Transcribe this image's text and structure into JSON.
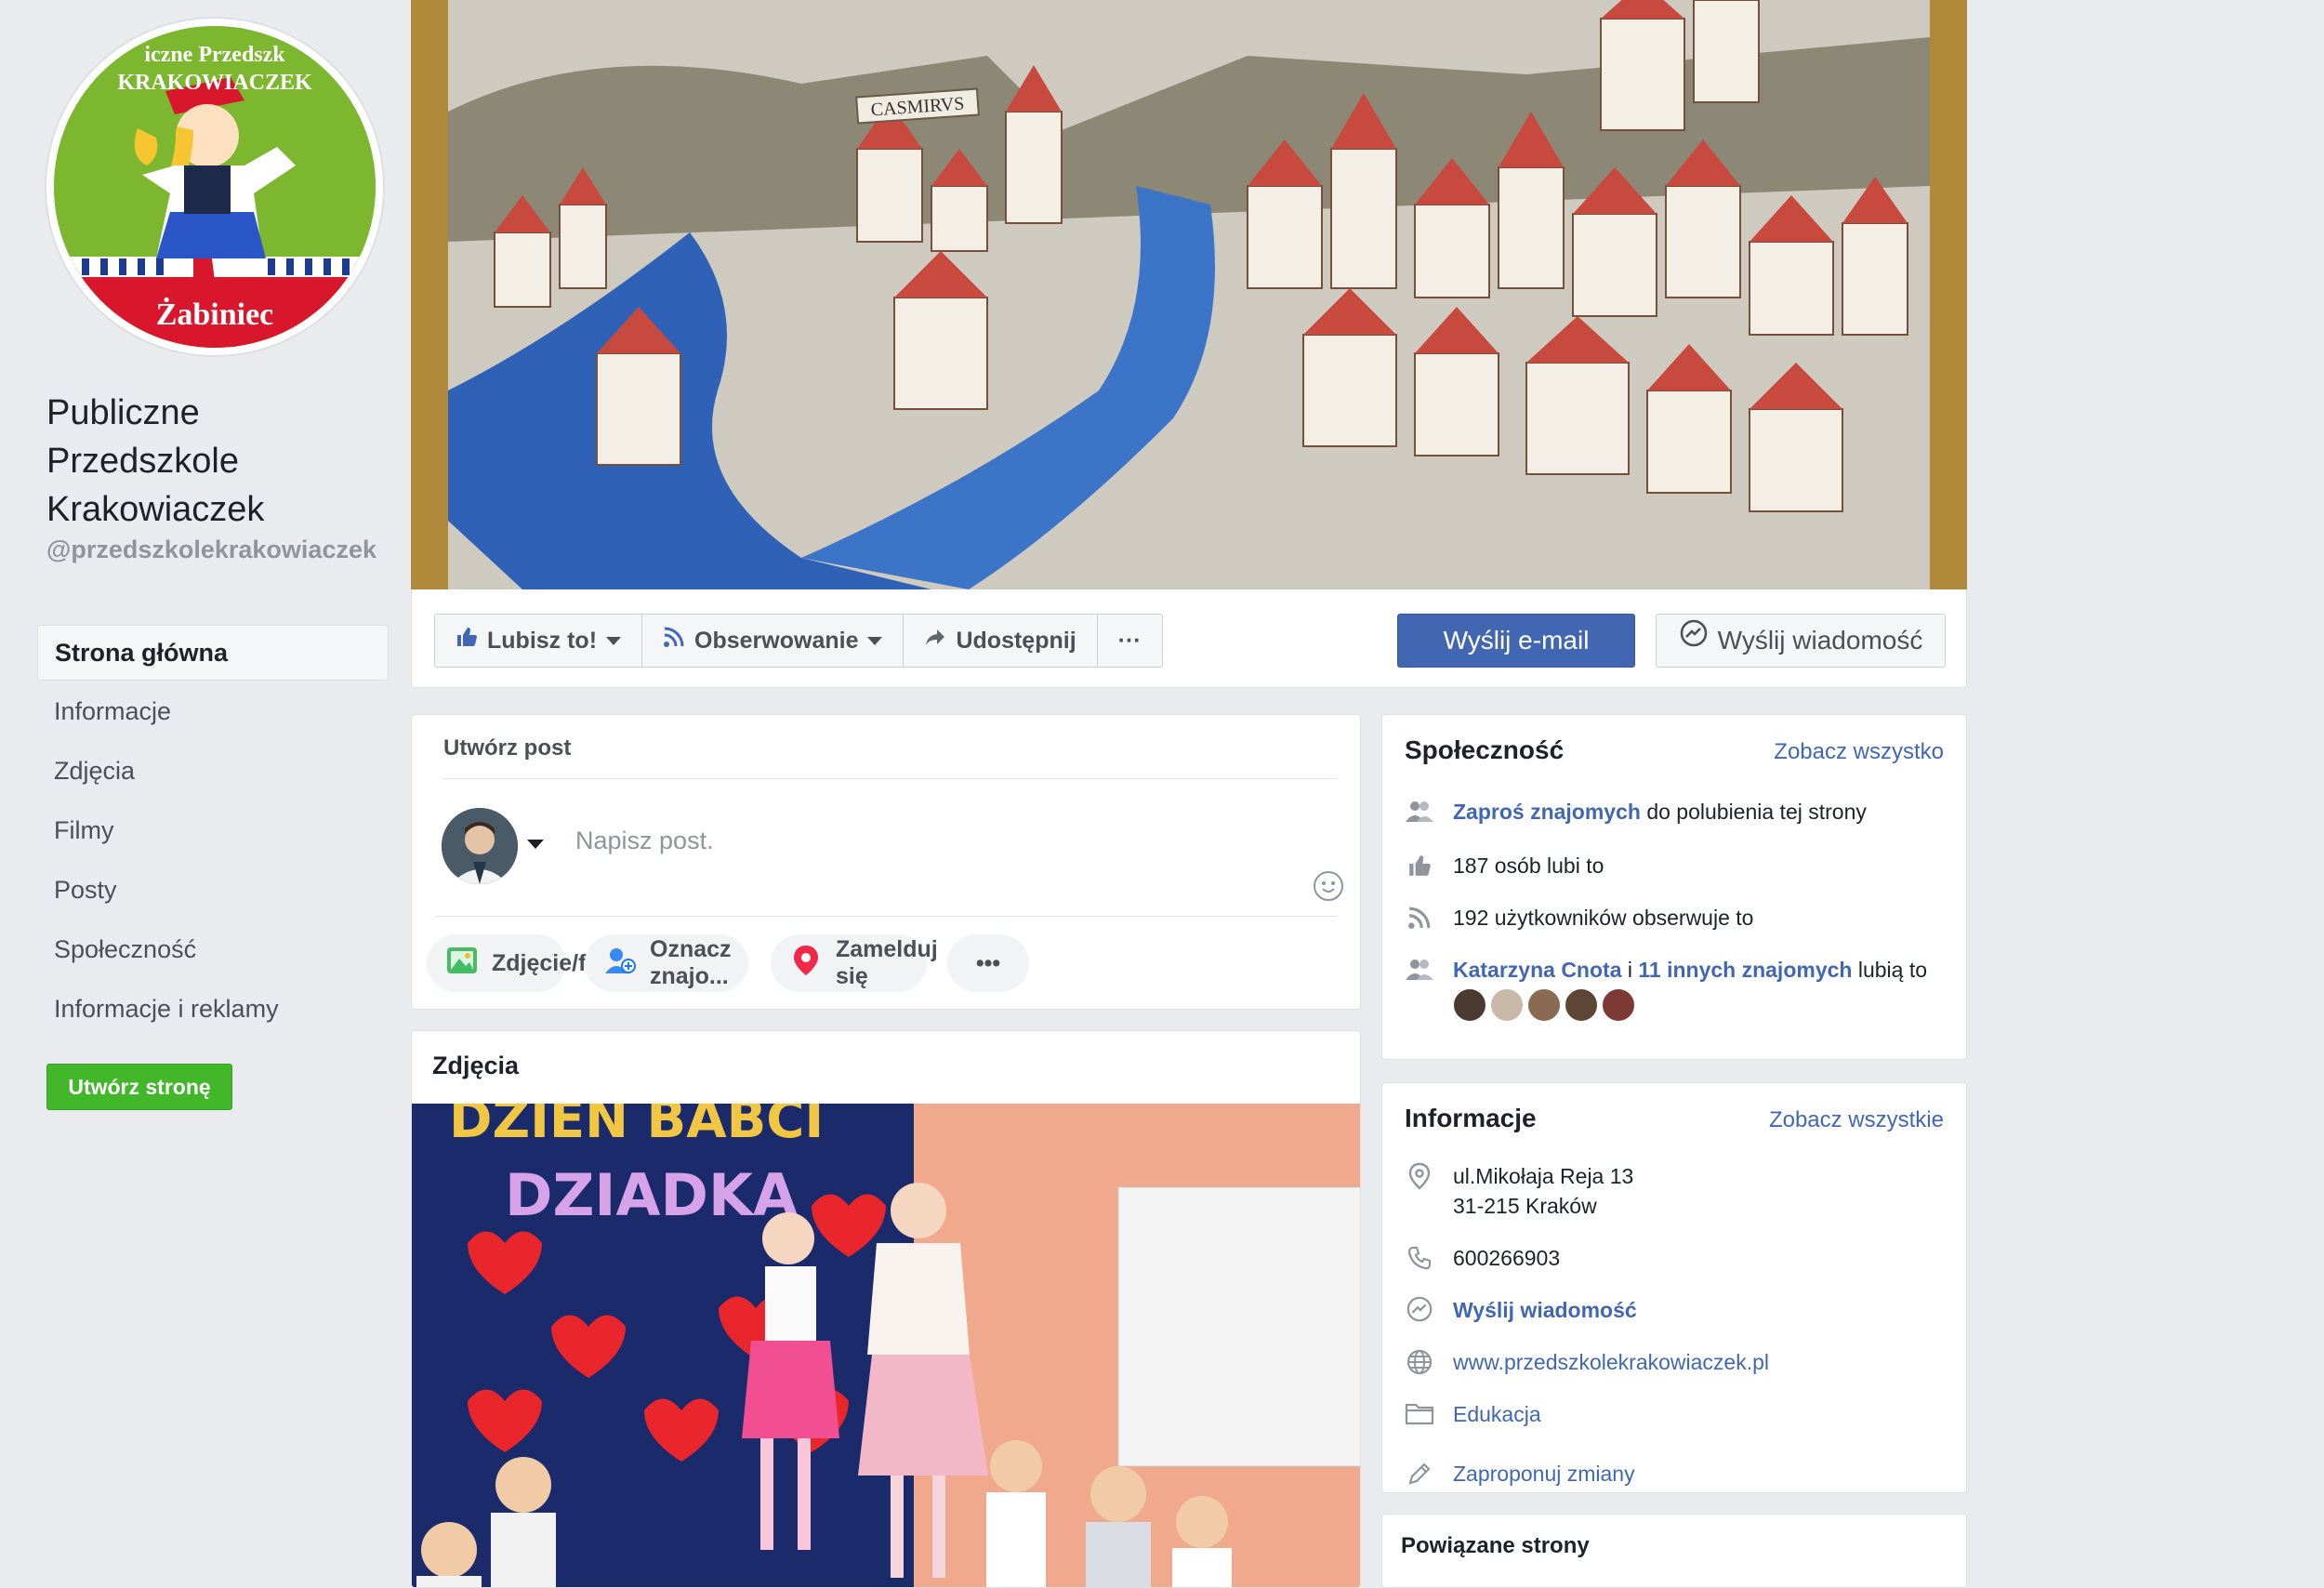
{
  "profile": {
    "logo_top": "iczne Przedszk",
    "logo_mid": "KRAKOWIACZEK",
    "logo_bottom": "Żabiniec",
    "name_line1": "Publiczne",
    "name_line2": "Przedszkole",
    "name_line3": "Krakowiaczek",
    "handle": "@przedszkolekrakowiaczek"
  },
  "leftnav": {
    "items": [
      {
        "label": "Strona główna",
        "active": true
      },
      {
        "label": "Informacje"
      },
      {
        "label": "Zdjęcia"
      },
      {
        "label": "Filmy"
      },
      {
        "label": "Posty"
      },
      {
        "label": "Społeczność"
      },
      {
        "label": "Informacje i reklamy"
      }
    ],
    "create_page": "Utwórz stronę"
  },
  "cover": {
    "banner_text": "CASMIRVS"
  },
  "actions": {
    "like": "Lubisz to!",
    "follow": "Obserwowanie",
    "share": "Udostępnij",
    "more": "···",
    "email": "Wyślij e-mail",
    "message": "Wyślij wiadomość"
  },
  "create_post": {
    "title": "Utwórz post",
    "placeholder": "Napisz post.",
    "photo": "Zdjęcie/film",
    "tag": "Oznacz znajo...",
    "checkin": "Zamelduj się",
    "more": "•••"
  },
  "photos": {
    "title": "Zdjęcia",
    "banner_line1": "DZIEN BABCI",
    "banner_line2": "DZIADKA"
  },
  "community": {
    "title": "Społeczność",
    "see_all": "Zobacz wszystko",
    "invite_link": "Zaproś znajomych",
    "invite_rest": " do polubienia tej strony",
    "likes": "187 osób lubi to",
    "follows": "192 użytkowników obserwuje to",
    "friend_name": "Katarzyna Cnota",
    "friend_and": " i ",
    "friend_others": "11 innych znajomych",
    "friend_rest": " lubią to"
  },
  "info": {
    "title": "Informacje",
    "see_all": "Zobacz wszystkie",
    "address1": "ul.Mikołaja Reja 13",
    "address2": "31-215 Kraków",
    "phone": "600266903",
    "send_message": "Wyślij wiadomość",
    "website": "www.przedszkolekrakowiaczek.pl",
    "category": "Edukacja",
    "suggest": "Zaproponuj zmiany"
  },
  "related": {
    "title": "Powiązane strony"
  },
  "colors": {
    "brand": "#4267b2",
    "green": "#42b72a",
    "bg": "#e9ebee"
  }
}
